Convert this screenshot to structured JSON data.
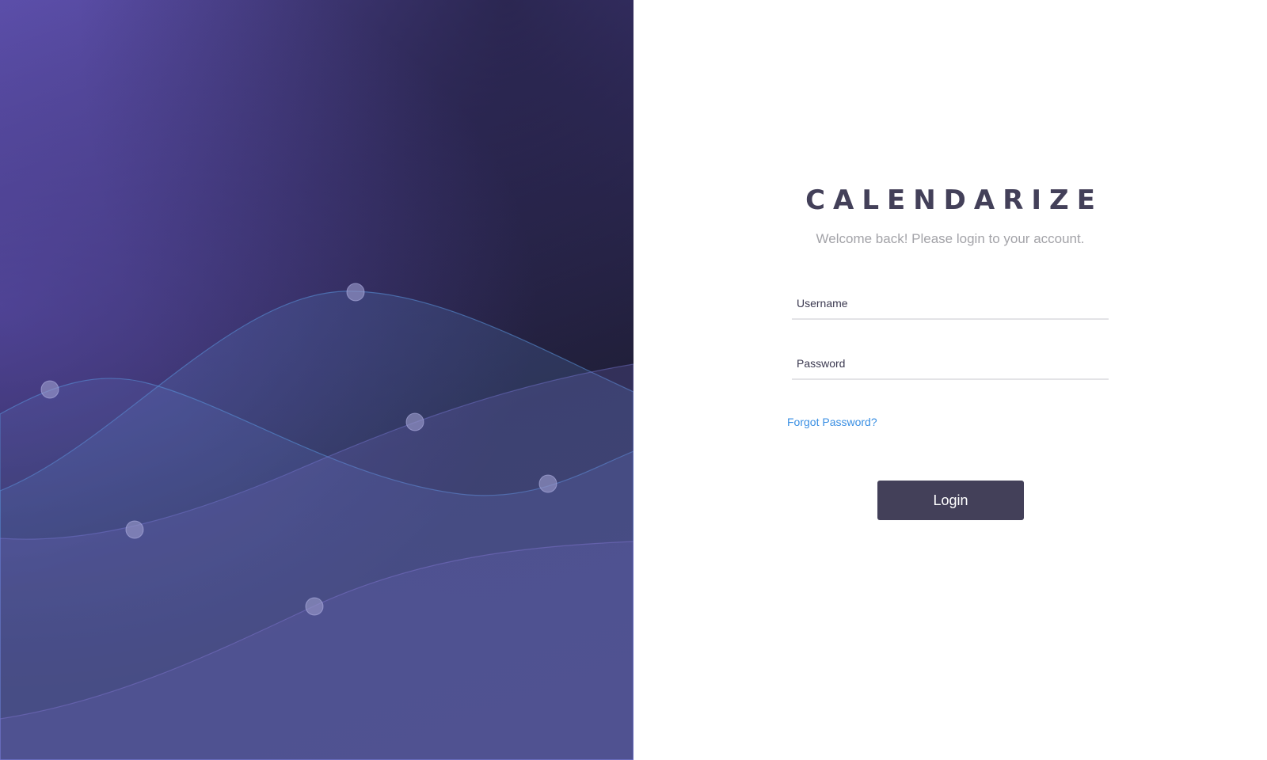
{
  "brand": {
    "name": "CALENDARIZE",
    "subtitle": "Welcome back! Please login to your account."
  },
  "form": {
    "username": {
      "placeholder": "Username",
      "value": ""
    },
    "password": {
      "placeholder": "Password",
      "value": ""
    },
    "forgot_label": "Forgot Password?",
    "login_label": "Login"
  },
  "colors": {
    "brand_text": "#434059",
    "subtitle_text": "#a3a3a8",
    "link": "#3a8fe3",
    "button_bg": "#434059",
    "hero_dark": "#24223f",
    "hero_light": "#5b4ea8"
  }
}
